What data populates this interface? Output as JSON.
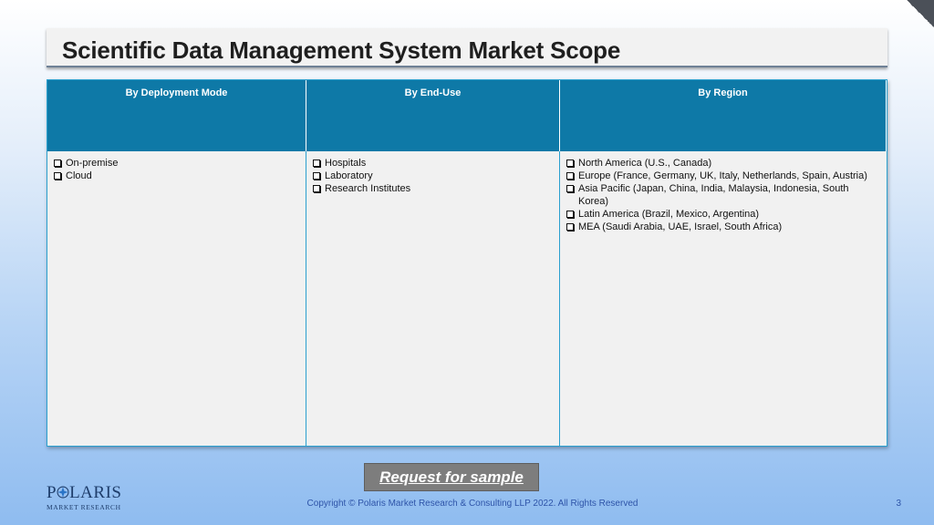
{
  "slide": {
    "title": "Scientific Data Management System Market Scope",
    "page_number": "3"
  },
  "table": {
    "columns": [
      {
        "header": "By Deployment Mode",
        "items": [
          "On-premise",
          "Cloud"
        ]
      },
      {
        "header": "By End-Use",
        "items": [
          "Hospitals",
          "Laboratory",
          "Research Institutes"
        ]
      },
      {
        "header": "By Region",
        "items": [
          "North America (U.S., Canada)",
          "Europe (France, Germany, UK, Italy, Netherlands, Spain, Austria)",
          "Asia Pacific (Japan, China, India, Malaysia, Indonesia, South Korea)",
          "Latin America (Brazil, Mexico, Argentina)",
          "MEA (Saudi Arabia, UAE, Israel, South Africa)"
        ]
      }
    ]
  },
  "cta": {
    "label": "Request for sample"
  },
  "logo": {
    "main": "POLARIS",
    "sub": "MARKET RESEARCH"
  },
  "footer": {
    "copyright": "Copyright © Polaris Market Research & Consulting LLP 2022. All Rights Reserved"
  },
  "colors": {
    "header_fill": "#0e79a7",
    "border": "#2aa0cf",
    "footer_text": "#2e54a8",
    "button_fill": "#7d7d7d"
  },
  "icons": {
    "bullet": "checkbox-bullet-icon",
    "corner": "page-corner-icon",
    "logo_star": "compass-star-icon"
  }
}
